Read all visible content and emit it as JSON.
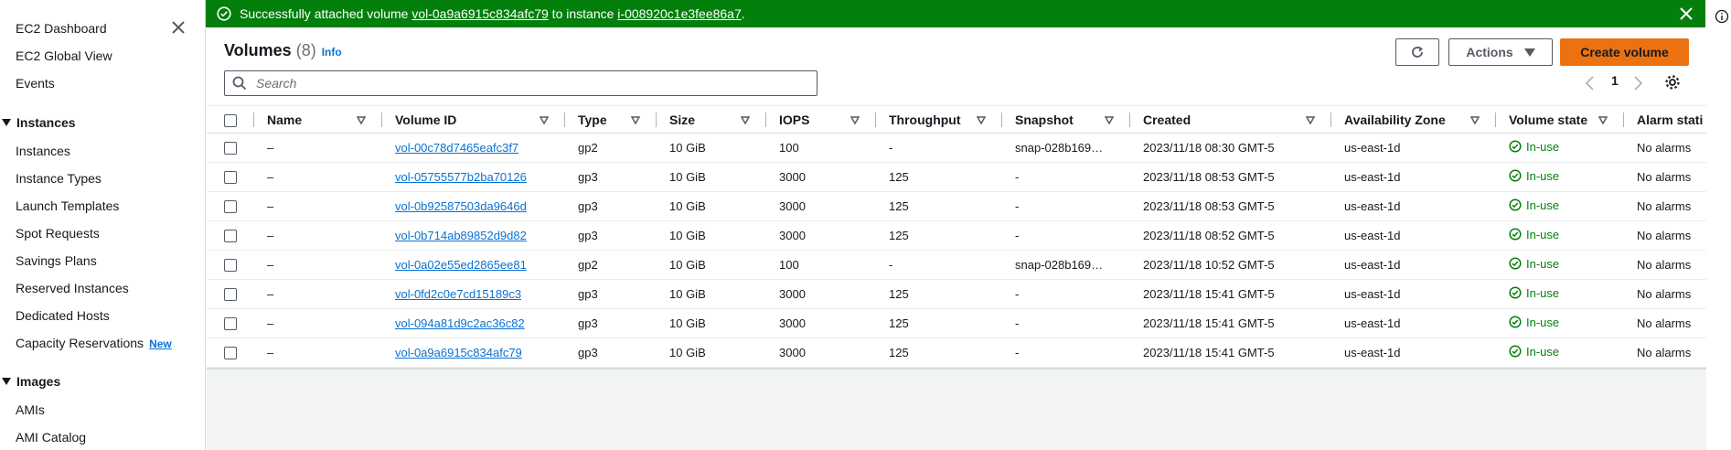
{
  "sidebar": {
    "items": [
      {
        "label": "EC2 Dashboard"
      },
      {
        "label": "EC2 Global View"
      },
      {
        "label": "Events"
      }
    ],
    "sections": [
      {
        "title": "Instances",
        "items": [
          "Instances",
          "Instance Types",
          "Launch Templates",
          "Spot Requests",
          "Savings Plans",
          "Reserved Instances",
          "Dedicated Hosts",
          "Capacity Reservations"
        ]
      },
      {
        "title": "Images",
        "items": [
          "AMIs",
          "AMI Catalog"
        ]
      }
    ],
    "new_badge": "New"
  },
  "flash": {
    "prefix": "Successfully attached volume ",
    "volume_link": "vol-0a9a6915c834afc79",
    "middle": " to instance ",
    "instance_link": "i-008920c1e3fee86a7",
    "suffix": ".",
    "color": "#037f0c"
  },
  "header": {
    "title": "Volumes",
    "count": "(8)",
    "info": "Info",
    "actions_label": "Actions",
    "create_label": "Create volume",
    "accent": "#ec7211"
  },
  "search": {
    "placeholder": "Search",
    "value": ""
  },
  "pager": {
    "page": "1"
  },
  "table": {
    "columns": [
      "Name",
      "Volume ID",
      "Type",
      "Size",
      "IOPS",
      "Throughput",
      "Snapshot",
      "Created",
      "Availability Zone",
      "Volume state",
      "Alarm stati"
    ],
    "rows": [
      [
        "–",
        "vol-00c78d7465eafc3f7",
        "gp2",
        "10 GiB",
        "100",
        "-",
        "snap-028b169…",
        "2023/11/18 08:30 GMT-5",
        "us-east-1d",
        "In-use",
        "No alarms"
      ],
      [
        "–",
        "vol-05755577b2ba70126",
        "gp3",
        "10 GiB",
        "3000",
        "125",
        "-",
        "2023/11/18 08:53 GMT-5",
        "us-east-1d",
        "In-use",
        "No alarms"
      ],
      [
        "–",
        "vol-0b92587503da9646d",
        "gp3",
        "10 GiB",
        "3000",
        "125",
        "-",
        "2023/11/18 08:53 GMT-5",
        "us-east-1d",
        "In-use",
        "No alarms"
      ],
      [
        "–",
        "vol-0b714ab89852d9d82",
        "gp3",
        "10 GiB",
        "3000",
        "125",
        "-",
        "2023/11/18 08:52 GMT-5",
        "us-east-1d",
        "In-use",
        "No alarms"
      ],
      [
        "–",
        "vol-0a02e55ed2865ee81",
        "gp2",
        "10 GiB",
        "100",
        "-",
        "snap-028b169…",
        "2023/11/18 10:52 GMT-5",
        "us-east-1d",
        "In-use",
        "No alarms"
      ],
      [
        "–",
        "vol-0fd2c0e7cd15189c3",
        "gp3",
        "10 GiB",
        "3000",
        "125",
        "-",
        "2023/11/18 15:41 GMT-5",
        "us-east-1d",
        "In-use",
        "No alarms"
      ],
      [
        "–",
        "vol-094a81d9c2ac36c82",
        "gp3",
        "10 GiB",
        "3000",
        "125",
        "-",
        "2023/11/18 15:41 GMT-5",
        "us-east-1d",
        "In-use",
        "No alarms"
      ],
      [
        "–",
        "vol-0a9a6915c834afc79",
        "gp3",
        "10 GiB",
        "3000",
        "125",
        "-",
        "2023/11/18 15:41 GMT-5",
        "us-east-1d",
        "In-use",
        "No alarms"
      ]
    ]
  }
}
